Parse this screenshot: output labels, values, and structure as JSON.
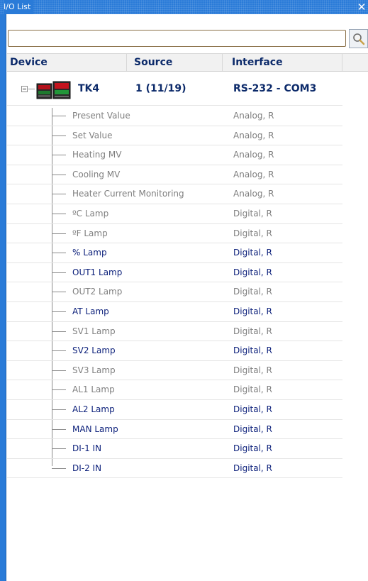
{
  "window": {
    "title": "I/O List",
    "close_glyph": "✕"
  },
  "search": {
    "value": "",
    "placeholder": ""
  },
  "columns": {
    "device": "Device",
    "source": "Source",
    "interface": "Interface"
  },
  "device": {
    "name": "TK4",
    "source": "1 (11/19)",
    "interface": "RS-232 - COM3",
    "expanded": true
  },
  "items": [
    {
      "label": "Present Value",
      "interface": "Analog, R",
      "enabled": false
    },
    {
      "label": "Set Value",
      "interface": "Analog, R",
      "enabled": false
    },
    {
      "label": "Heating MV",
      "interface": "Analog, R",
      "enabled": false
    },
    {
      "label": "Cooling MV",
      "interface": "Analog, R",
      "enabled": false
    },
    {
      "label": "Heater Current Monitoring",
      "interface": "Analog, R",
      "enabled": false
    },
    {
      "label": "ºC Lamp",
      "interface": "Digital, R",
      "enabled": false
    },
    {
      "label": "ºF Lamp",
      "interface": "Digital, R",
      "enabled": false
    },
    {
      "label": "% Lamp",
      "interface": "Digital, R",
      "enabled": true
    },
    {
      "label": "OUT1 Lamp",
      "interface": "Digital, R",
      "enabled": true
    },
    {
      "label": "OUT2 Lamp",
      "interface": "Digital, R",
      "enabled": false
    },
    {
      "label": "AT Lamp",
      "interface": "Digital, R",
      "enabled": true
    },
    {
      "label": "SV1 Lamp",
      "interface": "Digital, R",
      "enabled": false
    },
    {
      "label": "SV2 Lamp",
      "interface": "Digital, R",
      "enabled": true
    },
    {
      "label": "SV3 Lamp",
      "interface": "Digital, R",
      "enabled": false
    },
    {
      "label": "AL1 Lamp",
      "interface": "Digital, R",
      "enabled": false
    },
    {
      "label": "AL2 Lamp",
      "interface": "Digital, R",
      "enabled": true
    },
    {
      "label": "MAN Lamp",
      "interface": "Digital, R",
      "enabled": true
    },
    {
      "label": "DI-1 IN",
      "interface": "Digital, R",
      "enabled": true
    },
    {
      "label": "DI-2 IN",
      "interface": "Digital, R",
      "enabled": true
    }
  ],
  "colors": {
    "titlebar": "#2a7bd8",
    "enabled_text": "#0b1f7a",
    "disabled_text": "#7f7f7f",
    "header_text": "#0c2a6a"
  },
  "icons": {
    "search": "magnifier-icon",
    "close": "close-icon",
    "device": "controller-device-icon",
    "expander": "collapse-minus-icon"
  }
}
